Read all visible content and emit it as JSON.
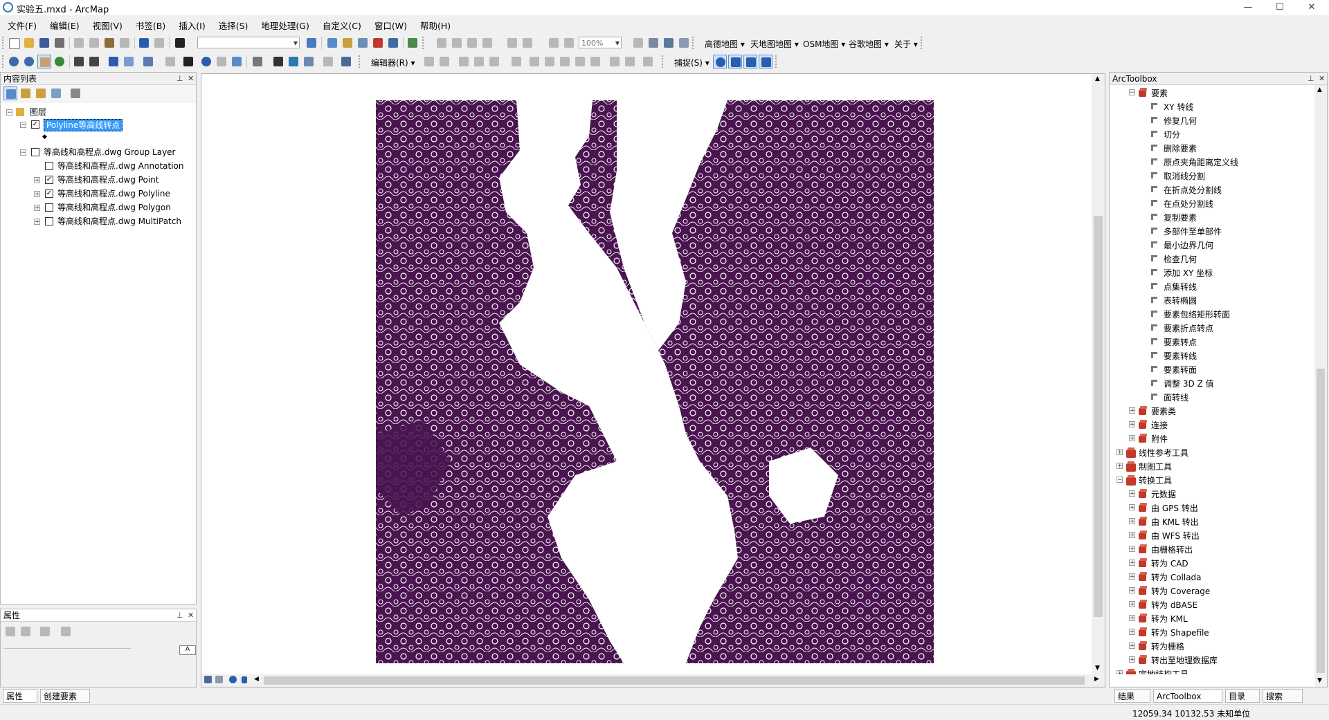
{
  "window": {
    "title": "实验五.mxd - ArcMap",
    "min": "—",
    "max": "☐",
    "close": "✕"
  },
  "menus": [
    "文件(F)",
    "编辑(E)",
    "视图(V)",
    "书签(B)",
    "插入(I)",
    "选择(S)",
    "地理处理(G)",
    "自定义(C)",
    "窗口(W)",
    "帮助(H)"
  ],
  "toolbar1": {
    "map_menus": [
      "高德地图",
      "天地图地图",
      "OSM地图",
      "谷歌地图",
      "关于"
    ],
    "scale_value": "",
    "zoom_value": "100%"
  },
  "toolbar2": {
    "editor_label": "编辑器(R)",
    "snap_label": "捕捉(S)"
  },
  "toc": {
    "title": "内容列表",
    "root": "图层",
    "layers": [
      {
        "name": "Polyline等高线转点",
        "checked": true,
        "selected": true,
        "expander": "−"
      },
      {
        "name": "等高线和高程点.dwg Group Layer",
        "checked": false,
        "expander": "−"
      },
      {
        "name": "等高线和高程点.dwg Annotation",
        "checked": false,
        "expander": ""
      },
      {
        "name": "等高线和高程点.dwg Point",
        "checked": true,
        "expander": "+"
      },
      {
        "name": "等高线和高程点.dwg Polyline",
        "checked": true,
        "expander": "+"
      },
      {
        "name": "等高线和高程点.dwg Polygon",
        "checked": false,
        "expander": "+"
      },
      {
        "name": "等高线和高程点.dwg MultiPatch",
        "checked": false,
        "expander": "+"
      }
    ],
    "symbol": "◆"
  },
  "properties": {
    "title": "属性"
  },
  "bottom_tabs_left": [
    "属性",
    "创建要素"
  ],
  "arctoolbox": {
    "title": "ArcToolbox",
    "toolset_open": "要素",
    "tools": [
      "XY 转线",
      "修复几何",
      "切分",
      "删除要素",
      "原点夹角距离定义线",
      "取消线分割",
      "在折点处分割线",
      "在点处分割线",
      "复制要素",
      "多部件至单部件",
      "最小边界几何",
      "检查几何",
      "添加 XY 坐标",
      "点集转线",
      "表转椭圆",
      "要素包络矩形转面",
      "要素折点转点",
      "要素转点",
      "要素转线",
      "要素转面",
      "调整 3D Z 值",
      "面转线"
    ],
    "toolsets_after": [
      "要素类",
      "连接",
      "附件"
    ],
    "toolboxes_mid": [
      "线性参考工具",
      "制图工具"
    ],
    "conversion_box": "转换工具",
    "conversion_sets": [
      "元数据",
      "由 GPS 转出",
      "由 KML 转出",
      "由 WFS 转出",
      "由栅格转出",
      "转为 CAD",
      "转为 Collada",
      "转为 Coverage",
      "转为 dBASE",
      "转为 KML",
      "转为 Shapefile",
      "转为栅格",
      "转出至地理数据库"
    ],
    "toolbox_last": "宗地结构工具"
  },
  "bottom_tabs_right": [
    "结果",
    "ArcToolbox",
    "目录",
    "搜索"
  ],
  "status": {
    "coords": "12059.34  10132.53 未知单位"
  },
  "colors": {
    "map_fill": "#4a1450",
    "selection": "#3399ff"
  }
}
